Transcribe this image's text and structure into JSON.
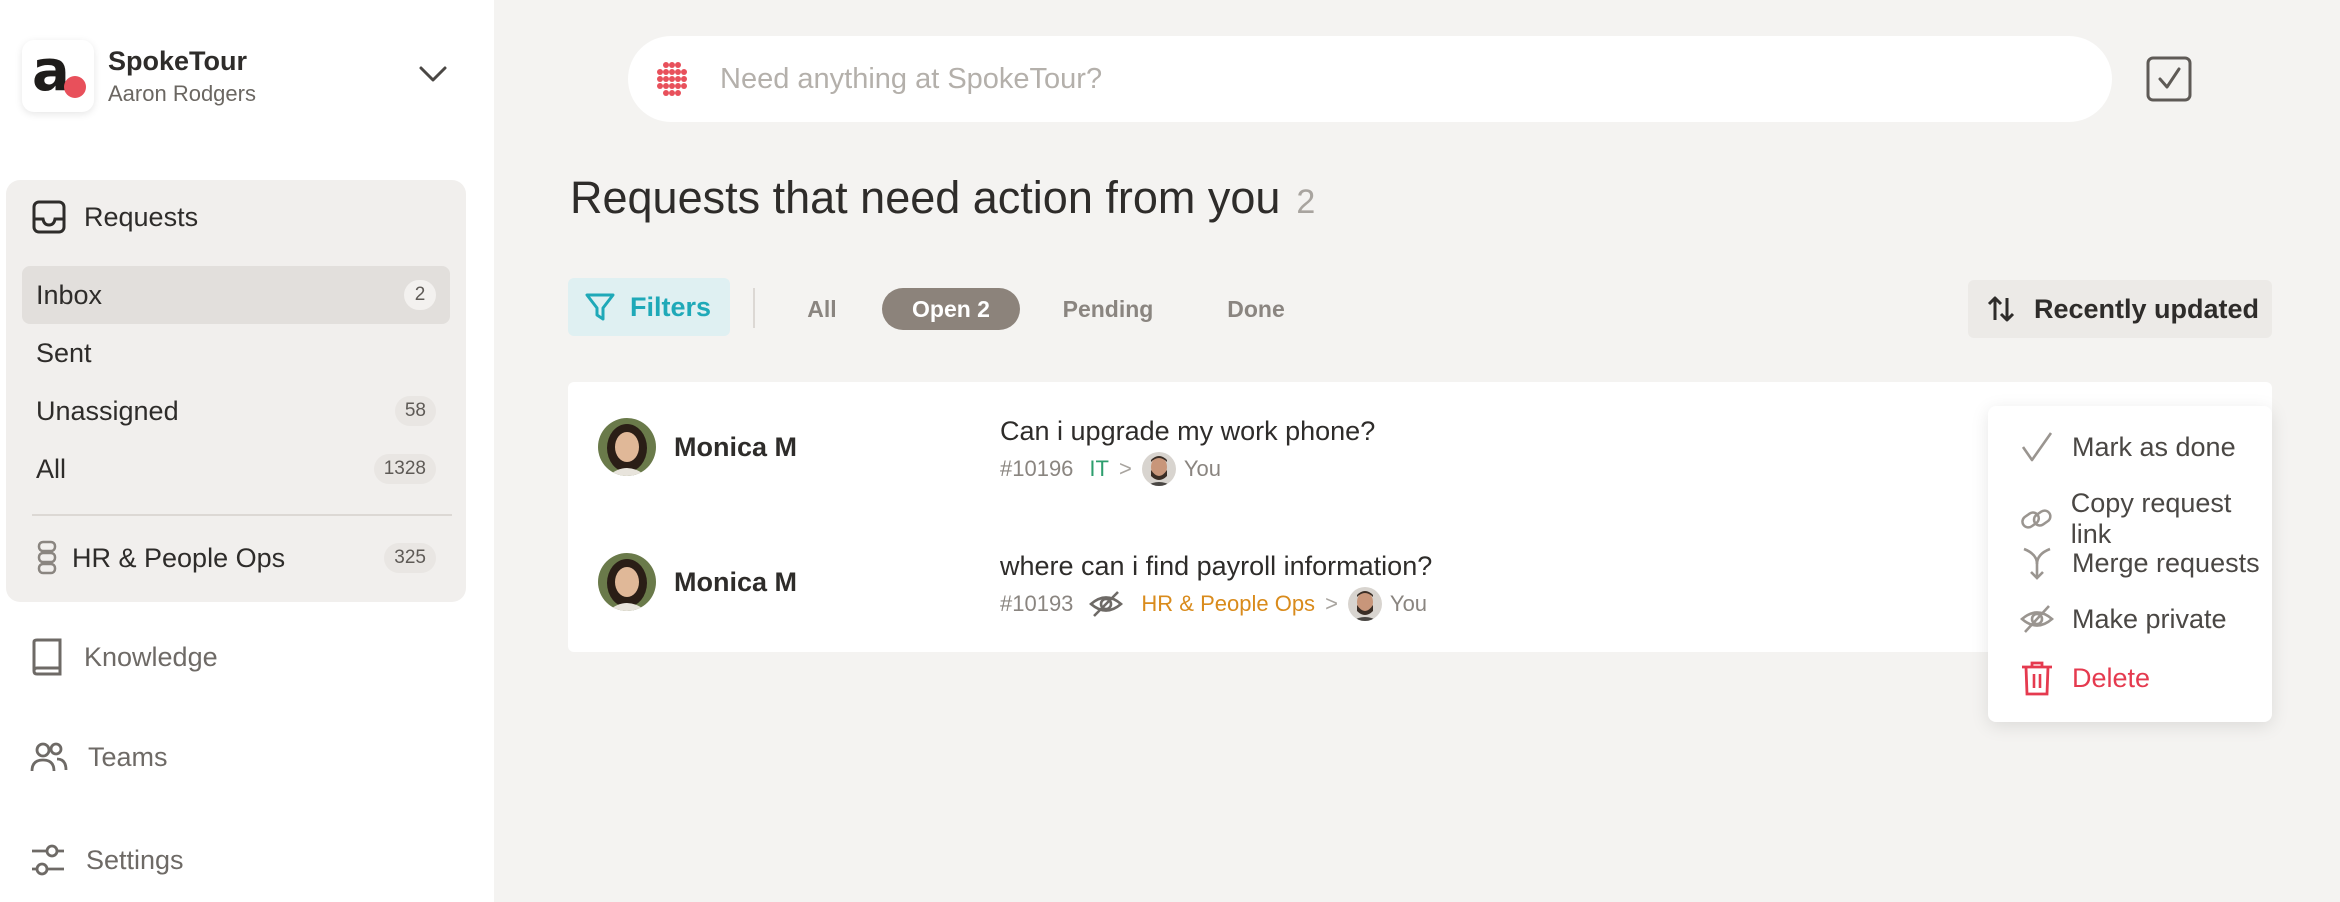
{
  "brand": {
    "name": "SpokeTour",
    "user": "Aaron Rodgers"
  },
  "sidebar": {
    "requests_label": "Requests",
    "items": [
      {
        "label": "Inbox",
        "count": "2"
      },
      {
        "label": "Sent",
        "count": ""
      },
      {
        "label": "Unassigned",
        "count": "58"
      },
      {
        "label": "All",
        "count": "1328"
      }
    ],
    "team": {
      "label": "HR & People Ops",
      "count": "325"
    },
    "links": [
      {
        "label": "Knowledge"
      },
      {
        "label": "Teams"
      },
      {
        "label": "Settings"
      }
    ]
  },
  "search": {
    "placeholder": "Need anything at SpokeTour?"
  },
  "page": {
    "title": "Requests that need action from you",
    "count": "2"
  },
  "toolbar": {
    "filters_label": "Filters",
    "tabs": [
      {
        "label": "All"
      },
      {
        "label": "Open 2"
      },
      {
        "label": "Pending"
      },
      {
        "label": "Done"
      }
    ],
    "sort_label": "Recently updated"
  },
  "requests": [
    {
      "name": "Monica M",
      "subject": "Can i upgrade my work phone?",
      "id": "#10196",
      "team": "IT",
      "assignee": "You"
    },
    {
      "name": "Monica M",
      "subject": "where can i find payroll information?",
      "id": "#10193",
      "team": "HR & People Ops",
      "assignee": "You"
    }
  ],
  "menu": {
    "items": [
      {
        "label": "Mark as done"
      },
      {
        "label": "Copy request link"
      },
      {
        "label": "Merge requests"
      },
      {
        "label": "Make private"
      },
      {
        "label": "Delete"
      }
    ]
  },
  "colors": {
    "accent": "#1fa9b8",
    "brand_dot": "#e8505b",
    "danger": "#e53a4f",
    "tag_it": "#2e9e6e",
    "tag_hr": "#d98b1c"
  }
}
